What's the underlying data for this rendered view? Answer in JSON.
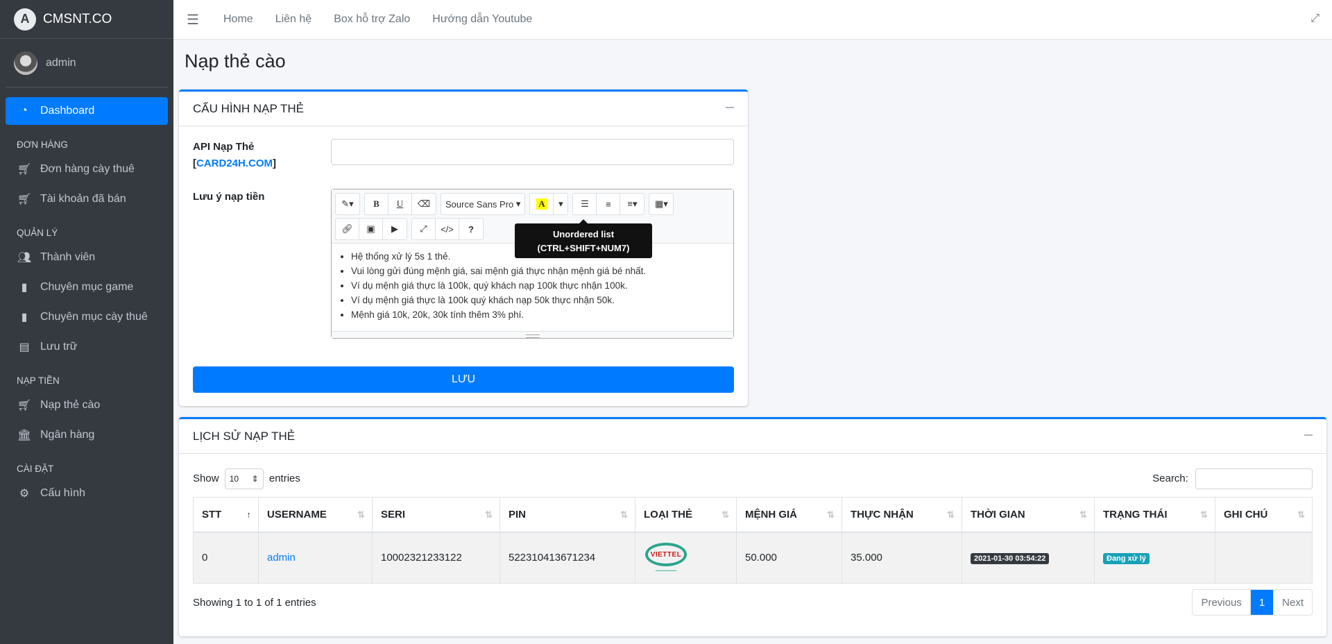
{
  "brand": {
    "logo_letter": "A",
    "name": "CMSNT.CO"
  },
  "user": {
    "name": "admin"
  },
  "sidebar": {
    "dashboard": "Dashboard",
    "sections": [
      {
        "header": "ĐƠN HÀNG",
        "items": [
          {
            "label": "Đơn hàng cày thuê",
            "icon": "cart-icon"
          },
          {
            "label": "Tài khoản đã bán",
            "icon": "cart-icon"
          }
        ]
      },
      {
        "header": "QUẢN LÝ",
        "items": [
          {
            "label": "Thành viên",
            "icon": "users-icon"
          },
          {
            "label": "Chuyên mục game",
            "icon": "file-icon"
          },
          {
            "label": "Chuyên mục cày thuê",
            "icon": "file-icon"
          },
          {
            "label": "Lưu trữ",
            "icon": "box-icon"
          }
        ]
      },
      {
        "header": "NẠP TIỀN",
        "items": [
          {
            "label": "Nạp thẻ cào",
            "icon": "cart-icon"
          },
          {
            "label": "Ngân hàng",
            "icon": "bank-icon"
          }
        ]
      },
      {
        "header": "CÀI ĐẶT",
        "items": [
          {
            "label": "Cấu hình",
            "icon": "gear-icon"
          }
        ]
      }
    ]
  },
  "topbar": {
    "links": [
      "Home",
      "Liên hệ",
      "Box hỗ trợ Zalo",
      "Hướng dẫn Youtube"
    ]
  },
  "page": {
    "title": "Nạp thẻ cào"
  },
  "config_card": {
    "title": "CẤU HÌNH NẠP THẺ",
    "api_label": "API Nạp Thẻ",
    "api_bracket_open": "[",
    "api_link": "CARD24H.COM",
    "api_bracket_close": "]",
    "api_value": "",
    "note_label": "Lưu ý nạp tiền",
    "font_name": "Source Sans Pro",
    "tooltip_title": "Unordered list",
    "tooltip_shortcut": "(CTRL+SHIFT+NUM7)",
    "notes": [
      "Hệ thống xử lý 5s 1 thẻ.",
      "Vui lòng gửi đúng mệnh giá, sai mệnh giá thực nhận mệnh giá bé nhất.",
      "Ví dụ mệnh giá thực là 100k, quý khách nạp 100k thực nhận 100k.",
      "Ví dụ mệnh giá thực là 100k quý khách nạp 50k thực nhận 50k.",
      "Mệnh giá 10k, 20k, 30k tính thêm 3% phí."
    ],
    "save_label": "LƯU"
  },
  "history_card": {
    "title": "LỊCH SỬ NẠP THẺ",
    "show_label": "Show",
    "entries_value": "10",
    "entries_label": "entries",
    "search_label": "Search:",
    "columns": [
      "STT",
      "USERNAME",
      "SERI",
      "PIN",
      "LOẠI THẺ",
      "MỆNH GIÁ",
      "THỰC NHẬN",
      "THỜI GIAN",
      "TRẠNG THÁI",
      "GHI CHÚ"
    ],
    "rows": [
      {
        "stt": "0",
        "username": "admin",
        "seri": "10002321233122",
        "pin": "522310413671234",
        "card_type": "viettel-logo",
        "logo_text": "VIETTEL",
        "menh_gia": "50.000",
        "thuc_nhan": "35.000",
        "thoi_gian": "2021-01-30 03:54:22",
        "trang_thai": "Đang xử lý",
        "ghi_chu": ""
      }
    ],
    "info": "Showing 1 to 1 of 1 entries",
    "pager": {
      "prev": "Previous",
      "current": "1",
      "next": "Next"
    }
  },
  "colors": {
    "primary": "#007bff",
    "sidebar": "#343a40",
    "info": "#17a2b8"
  }
}
